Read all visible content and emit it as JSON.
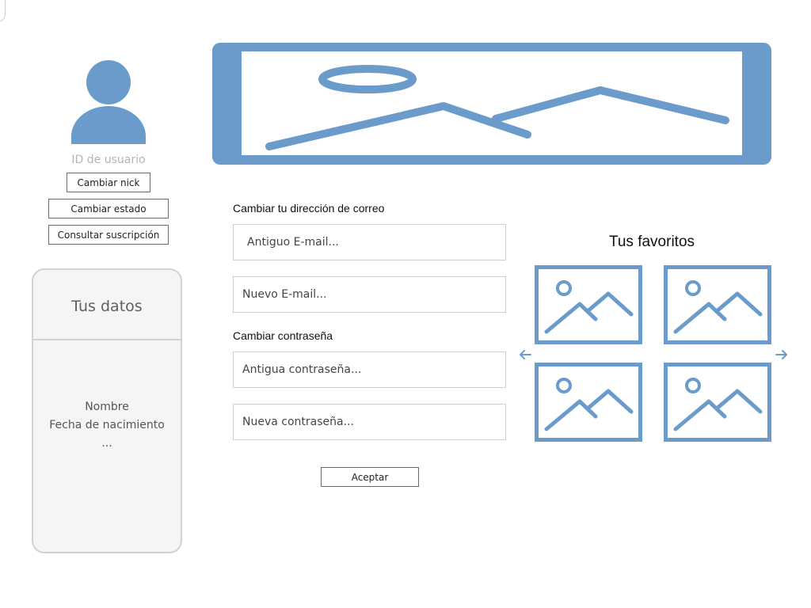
{
  "profile": {
    "user_id_label": "ID de usuario",
    "buttons": {
      "change_nick": "Cambiar nick",
      "change_status": "Cambiar estado",
      "view_subscription": "Consultar suscripción"
    }
  },
  "data_card": {
    "title": "Tus datos",
    "line1": "Nombre",
    "line2": "Fecha de nacimiento",
    "line3": "..."
  },
  "email_section": {
    "label": "Cambiar tu dirección de correo",
    "old_placeholder": "Antiguo E-mail...",
    "new_placeholder": "Nuevo E-mail..."
  },
  "password_section": {
    "label": "Cambiar contraseña",
    "old_placeholder": "Antigua contraseña...",
    "new_placeholder": "Nueva contraseña..."
  },
  "accept_button": "Aceptar",
  "favorites": {
    "title": "Tus favoritos"
  },
  "icons": {
    "avatar": "user-avatar-icon",
    "banner": "image-placeholder-icon",
    "thumbnail": "image-placeholder-icon",
    "prev": "arrow-left-icon",
    "next": "arrow-right-icon"
  },
  "colors": {
    "accent": "#6a9bcb",
    "card_bg": "#f5f5f5",
    "card_border": "#d2d2d2",
    "muted_text": "#b4b4b4"
  }
}
